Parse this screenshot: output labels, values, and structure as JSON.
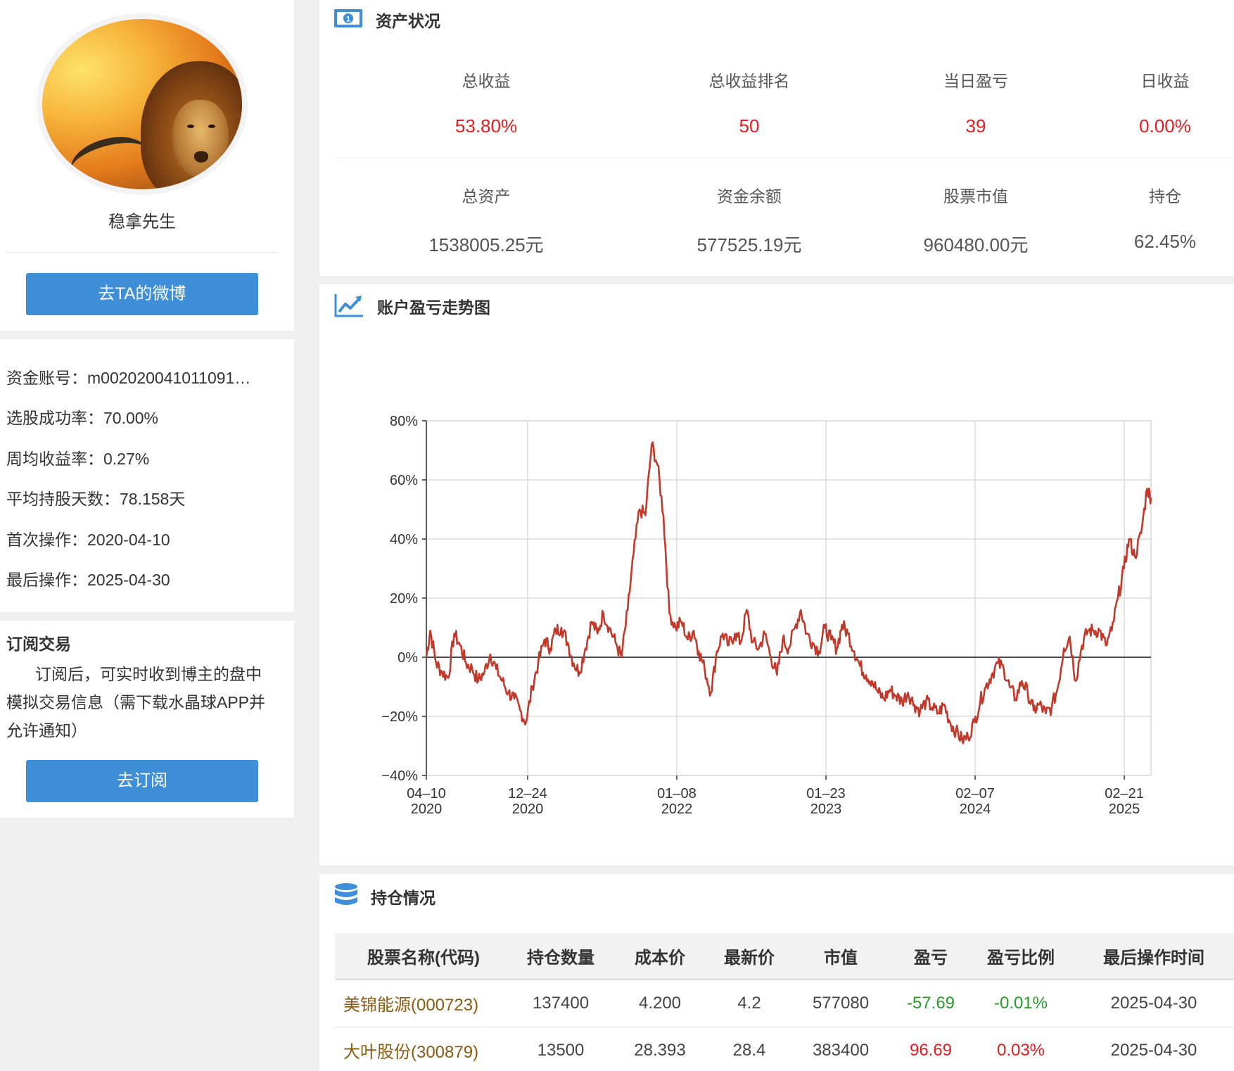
{
  "profile": {
    "nickname": "稳拿先生",
    "weibo_button": "去TA的微博"
  },
  "stats": [
    "资金账号：m002020041011091…",
    "选股成功率：70.00%",
    "周均收益率：0.27%",
    "平均持股天数：78.158天",
    "首次操作：2020-04-10",
    "最后操作：2025-04-30"
  ],
  "subscribe": {
    "title": "订阅交易",
    "description": "订阅后，可实时收到博主的盘中模拟交易信息（需下载水晶球APP并允许通知）",
    "button": "去订阅"
  },
  "assets": {
    "title": "资产状况",
    "row1": [
      {
        "label": "总收益",
        "value": "53.80%"
      },
      {
        "label": "总收益排名",
        "value": "50"
      },
      {
        "label": "当日盈亏",
        "value": "39"
      },
      {
        "label": "日收益",
        "value": "0.00%"
      }
    ],
    "row2": [
      {
        "label": "总资产",
        "value": "1538005.25元"
      },
      {
        "label": "资金余额",
        "value": "577525.19元"
      },
      {
        "label": "股票市值",
        "value": "960480.00元"
      },
      {
        "label": "持仓",
        "value": "62.45%"
      }
    ],
    "accent_color": "#e02020"
  },
  "chart_section": {
    "title": "账户盈亏走势图"
  },
  "chart_data": {
    "type": "line",
    "title": "",
    "xlabel": "",
    "ylabel": "",
    "ylim": [
      -40,
      80
    ],
    "y_ticks": [
      80,
      60,
      40,
      20,
      0,
      -20,
      -40
    ],
    "y_tick_labels": [
      "80%",
      "60%",
      "40%",
      "20%",
      "0%",
      "−20%",
      "−40%"
    ],
    "x_ticks": [
      {
        "date": "2020-04-10",
        "label1": "04–10",
        "label2": "2020"
      },
      {
        "date": "2020-12-24",
        "label1": "12–24",
        "label2": "2020"
      },
      {
        "date": "2022-01-08",
        "label1": "01–08",
        "label2": "2022"
      },
      {
        "date": "2023-01-23",
        "label1": "01–23",
        "label2": "2023"
      },
      {
        "date": "2024-02-07",
        "label1": "02–07",
        "label2": "2024"
      },
      {
        "date": "2025-02-21",
        "label1": "02–21",
        "label2": "2025"
      }
    ],
    "x_range": [
      "2020-04-10",
      "2025-04-30"
    ],
    "grid": true,
    "line_color": "#c0392b",
    "series": [
      {
        "points": [
          [
            "2020-04-10",
            0
          ],
          [
            "2020-04-20",
            9
          ],
          [
            "2020-05-05",
            -2
          ],
          [
            "2020-05-20",
            -5
          ],
          [
            "2020-06-05",
            -7
          ],
          [
            "2020-06-20",
            8
          ],
          [
            "2020-07-05",
            4
          ],
          [
            "2020-07-20",
            -2
          ],
          [
            "2020-08-05",
            -4
          ],
          [
            "2020-08-20",
            -8
          ],
          [
            "2020-09-05",
            -5
          ],
          [
            "2020-09-20",
            1
          ],
          [
            "2020-10-05",
            -4
          ],
          [
            "2020-10-20",
            -8
          ],
          [
            "2020-11-05",
            -12
          ],
          [
            "2020-11-20",
            -14
          ],
          [
            "2020-12-05",
            -18
          ],
          [
            "2020-12-20",
            -22
          ],
          [
            "2021-01-05",
            -10
          ],
          [
            "2021-01-20",
            -2
          ],
          [
            "2021-02-05",
            6
          ],
          [
            "2021-02-20",
            3
          ],
          [
            "2021-03-05",
            9
          ],
          [
            "2021-03-20",
            10
          ],
          [
            "2021-04-05",
            5
          ],
          [
            "2021-04-20",
            -2
          ],
          [
            "2021-05-05",
            -5
          ],
          [
            "2021-05-20",
            3
          ],
          [
            "2021-06-05",
            12
          ],
          [
            "2021-06-20",
            8
          ],
          [
            "2021-07-05",
            15
          ],
          [
            "2021-07-20",
            10
          ],
          [
            "2021-08-05",
            5
          ],
          [
            "2021-08-20",
            0
          ],
          [
            "2021-09-05",
            16
          ],
          [
            "2021-09-20",
            35
          ],
          [
            "2021-10-05",
            50
          ],
          [
            "2021-10-20",
            48
          ],
          [
            "2021-11-05",
            72
          ],
          [
            "2021-11-20",
            65
          ],
          [
            "2021-12-05",
            48
          ],
          [
            "2021-12-20",
            15
          ],
          [
            "2022-01-05",
            10
          ],
          [
            "2022-01-20",
            12
          ],
          [
            "2022-02-05",
            6
          ],
          [
            "2022-02-20",
            9
          ],
          [
            "2022-03-05",
            2
          ],
          [
            "2022-03-20",
            -4
          ],
          [
            "2022-04-05",
            -12
          ],
          [
            "2022-04-20",
            2
          ],
          [
            "2022-05-05",
            8
          ],
          [
            "2022-05-20",
            4
          ],
          [
            "2022-06-05",
            8
          ],
          [
            "2022-06-20",
            5
          ],
          [
            "2022-07-05",
            16
          ],
          [
            "2022-07-20",
            5
          ],
          [
            "2022-08-05",
            3
          ],
          [
            "2022-08-20",
            8
          ],
          [
            "2022-09-05",
            0
          ],
          [
            "2022-09-20",
            -6
          ],
          [
            "2022-10-05",
            6
          ],
          [
            "2022-10-20",
            3
          ],
          [
            "2022-11-05",
            10
          ],
          [
            "2022-11-20",
            16
          ],
          [
            "2022-12-05",
            8
          ],
          [
            "2022-12-20",
            5
          ],
          [
            "2023-01-05",
            2
          ],
          [
            "2023-01-20",
            10
          ],
          [
            "2023-02-05",
            6
          ],
          [
            "2023-02-20",
            3
          ],
          [
            "2023-03-05",
            11
          ],
          [
            "2023-03-20",
            8
          ],
          [
            "2023-04-05",
            2
          ],
          [
            "2023-04-20",
            -3
          ],
          [
            "2023-05-05",
            -6
          ],
          [
            "2023-05-20",
            -8
          ],
          [
            "2023-06-05",
            -12
          ],
          [
            "2023-06-20",
            -14
          ],
          [
            "2023-07-05",
            -11
          ],
          [
            "2023-07-20",
            -13
          ],
          [
            "2023-08-05",
            -15
          ],
          [
            "2023-08-20",
            -12
          ],
          [
            "2023-09-05",
            -16
          ],
          [
            "2023-09-20",
            -18
          ],
          [
            "2023-10-05",
            -15
          ],
          [
            "2023-10-20",
            -17
          ],
          [
            "2023-11-05",
            -19
          ],
          [
            "2023-11-20",
            -16
          ],
          [
            "2023-12-05",
            -22
          ],
          [
            "2023-12-20",
            -25
          ],
          [
            "2024-01-05",
            -28
          ],
          [
            "2024-01-20",
            -27
          ],
          [
            "2024-02-05",
            -22
          ],
          [
            "2024-02-20",
            -15
          ],
          [
            "2024-03-05",
            -10
          ],
          [
            "2024-03-20",
            -6
          ],
          [
            "2024-04-05",
            -2
          ],
          [
            "2024-04-20",
            -4
          ],
          [
            "2024-05-05",
            -10
          ],
          [
            "2024-05-20",
            -14
          ],
          [
            "2024-06-05",
            -8
          ],
          [
            "2024-06-20",
            -12
          ],
          [
            "2024-07-05",
            -18
          ],
          [
            "2024-07-20",
            -16
          ],
          [
            "2024-08-05",
            -19
          ],
          [
            "2024-08-20",
            -17
          ],
          [
            "2024-09-05",
            -10
          ],
          [
            "2024-09-20",
            3
          ],
          [
            "2024-10-05",
            7
          ],
          [
            "2024-10-20",
            -8
          ],
          [
            "2024-11-05",
            4
          ],
          [
            "2024-11-20",
            9
          ],
          [
            "2024-12-05",
            9
          ],
          [
            "2024-12-20",
            9
          ],
          [
            "2025-01-05",
            4
          ],
          [
            "2025-01-20",
            9
          ],
          [
            "2025-02-05",
            20
          ],
          [
            "2025-02-20",
            30
          ],
          [
            "2025-03-05",
            40
          ],
          [
            "2025-03-20",
            34
          ],
          [
            "2025-04-05",
            42
          ],
          [
            "2025-04-20",
            57
          ],
          [
            "2025-04-30",
            54
          ]
        ]
      }
    ]
  },
  "holdings": {
    "title": "持仓情况",
    "columns": [
      "股票名称(代码)",
      "持仓数量",
      "成本价",
      "最新价",
      "市值",
      "盈亏",
      "盈亏比例",
      "最后操作时间"
    ],
    "rows": [
      [
        "美锦能源(000723)",
        "137400",
        "4.200",
        "4.2",
        "577080",
        "-57.69",
        "-0.01%",
        "2025-04-30"
      ],
      [
        "大叶股份(300879)",
        "13500",
        "28.393",
        "28.4",
        "383400",
        "96.69",
        "0.03%",
        "2025-04-30"
      ]
    ]
  }
}
